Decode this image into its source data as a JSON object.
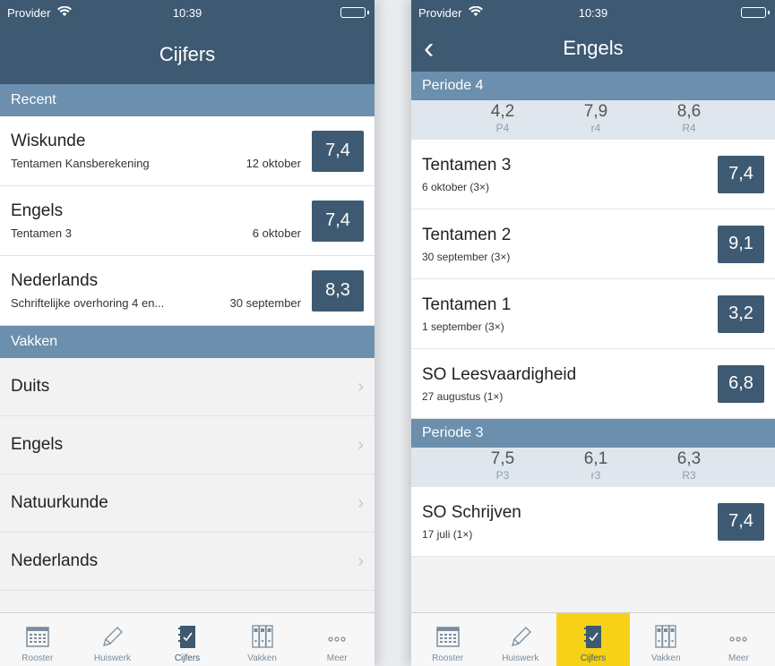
{
  "left": {
    "status": {
      "provider": "Provider",
      "time": "10:39"
    },
    "title": "Cijfers",
    "recent_header": "Recent",
    "recent": [
      {
        "subject": "Wiskunde",
        "description": "Tentamen Kansberekening",
        "date": "12 oktober",
        "grade": "7,4"
      },
      {
        "subject": "Engels",
        "description": "Tentamen 3",
        "date": "6 oktober",
        "grade": "7,4"
      },
      {
        "subject": "Nederlands",
        "description": "Schriftelijke overhoring 4 en...",
        "date": "30 september",
        "grade": "8,3"
      }
    ],
    "subjects_header": "Vakken",
    "subjects": [
      "Duits",
      "Engels",
      "Natuurkunde",
      "Nederlands"
    ]
  },
  "right": {
    "status": {
      "provider": "Provider",
      "time": "10:39"
    },
    "back_icon": "‹",
    "title": "Engels",
    "periods": [
      {
        "header": "Periode 4",
        "stats": [
          {
            "value": "4,2",
            "label": "P4"
          },
          {
            "value": "7,9",
            "label": "r4"
          },
          {
            "value": "8,6",
            "label": "R4"
          }
        ],
        "tests": [
          {
            "name": "Tentamen 3",
            "date": "6 oktober (3×)",
            "grade": "7,4"
          },
          {
            "name": "Tentamen 2",
            "date": "30 september (3×)",
            "grade": "9,1"
          },
          {
            "name": "Tentamen 1",
            "date": "1 september (3×)",
            "grade": "3,2"
          },
          {
            "name": "SO Leesvaardigheid",
            "date": "27 augustus (1×)",
            "grade": "6,8"
          }
        ]
      },
      {
        "header": "Periode 3",
        "stats": [
          {
            "value": "7,5",
            "label": "P3"
          },
          {
            "value": "6,1",
            "label": "r3"
          },
          {
            "value": "6,3",
            "label": "R3"
          }
        ],
        "tests": [
          {
            "name": "SO Schrijven",
            "date": "17 juli (1×)",
            "grade": "7,4"
          }
        ]
      }
    ]
  },
  "tabs": [
    {
      "label": "Rooster",
      "icon": "calendar-icon"
    },
    {
      "label": "Huiswerk",
      "icon": "pencil-icon"
    },
    {
      "label": "Cijfers",
      "icon": "grades-icon"
    },
    {
      "label": "Vakken",
      "icon": "binders-icon"
    },
    {
      "label": "Meer",
      "icon": "more-icon"
    }
  ],
  "colors": {
    "nav": "#3d5a72",
    "section": "#6b8fad",
    "active_tab": "#f7d117"
  }
}
